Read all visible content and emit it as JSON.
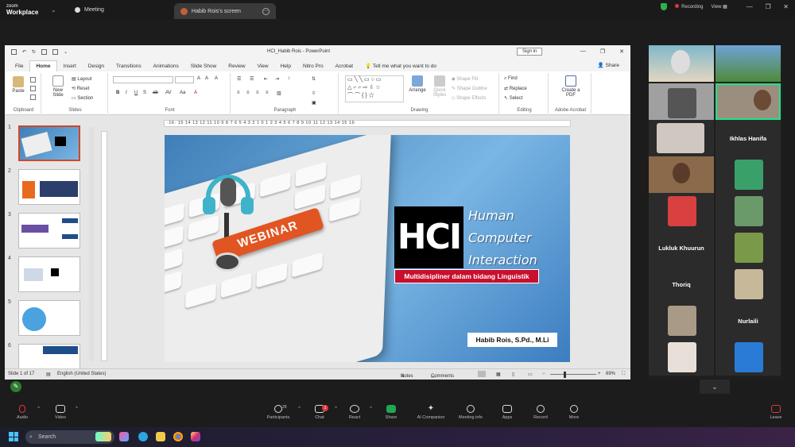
{
  "zoom": {
    "logo_line1": "zoom",
    "logo_line2": "Workplace",
    "tabs": [
      {
        "label": "Meeting"
      },
      {
        "label": "Habib Rois's screen"
      }
    ],
    "recording_label": "Recording",
    "view_label": "View"
  },
  "ppt": {
    "doc_title": "HCI_Habib Rois  -  PowerPoint",
    "signin_label": "Sign in",
    "tabs": [
      "File",
      "Home",
      "Insert",
      "Design",
      "Transitions",
      "Animations",
      "Slide Show",
      "Review",
      "View",
      "Help",
      "Nitro Pro",
      "Acrobat",
      "Tell me what you want to do"
    ],
    "share_label": "Share",
    "ribbon": {
      "paste": "Paste",
      "new_slide": "New Slide",
      "layout": "Layout",
      "reset": "Reset",
      "section": "Section",
      "arrange": "Arrange",
      "quick_styles": "Quick Styles",
      "shape_fill": "Shape Fill",
      "shape_outline": "Shape Outline",
      "shape_effects": "Shape Effects",
      "find": "Find",
      "replace": "Replace",
      "select": "Select",
      "create_pdf": "Create a PDF",
      "groups": [
        "Clipboard",
        "Slides",
        "Font",
        "Paragraph",
        "Drawing",
        "Editing",
        "Adobe Acrobat"
      ]
    },
    "ruler_text": "·16·  15  14  13  12  11  10  9  8  7  6  5  4  3  2  1  0  1  2  3  4  5  6  7  8  9  10  11  12  13  14  15  16·",
    "thumb_numbers": [
      "1",
      "2",
      "3",
      "4",
      "5",
      "6"
    ],
    "slide": {
      "webinar": "WEBINAR",
      "hci": "HCI",
      "line1": "Human",
      "line2": "Computer",
      "line3": "Interaction",
      "subtitle": "Multidisipliner dalam bidang Linguistik",
      "author": "Habib Rois, S.Pd., M.Li"
    },
    "status": {
      "slide_info": "Slide 1 of 17",
      "language": "English (United States)",
      "notes": "Notes",
      "comments": "Comments",
      "zoom": "69%"
    }
  },
  "gallery": {
    "names": [
      "Ikhlas Hanifa",
      "Lukluk Khuurun",
      "Thoriq",
      "Nurlaili"
    ]
  },
  "toolbar": {
    "audio": "Audio",
    "video": "Video",
    "participants": "Participants",
    "participants_count": "29",
    "chat": "Chat",
    "chat_badge": "1",
    "react": "React",
    "share": "Share",
    "ai": "AI Companion",
    "info": "Meeting info",
    "apps": "Apps",
    "record": "Record",
    "more": "More",
    "leave": "Leave"
  },
  "taskbar": {
    "search": "Search"
  }
}
